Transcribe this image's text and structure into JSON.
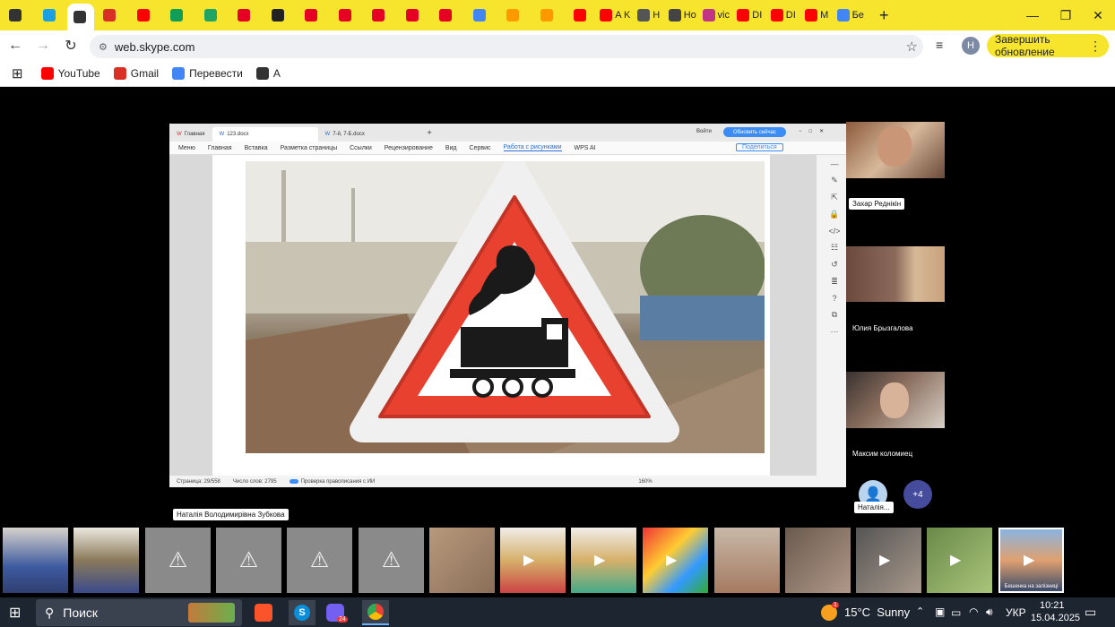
{
  "browser": {
    "tabs": [
      {
        "label": "",
        "icon": "chevron-down-icon",
        "color": "#333333"
      },
      {
        "label": "",
        "icon": "s-logo-icon",
        "color": "#1ba1e2"
      },
      {
        "label": "",
        "icon": "speaker-icon",
        "color": "#333333"
      },
      {
        "label": "",
        "icon": "gmail-icon",
        "color": "#d93025"
      },
      {
        "label": "",
        "icon": "youtube-icon",
        "color": "#ff0000"
      },
      {
        "label": "",
        "icon": "sheets-icon",
        "color": "#0f9d58"
      },
      {
        "label": "",
        "icon": "plus-green-icon",
        "color": "#1fa463"
      },
      {
        "label": "",
        "icon": "pinterest-icon",
        "color": "#e60023"
      },
      {
        "label": "",
        "icon": "hypothesis-icon",
        "color": "#222222"
      },
      {
        "label": "",
        "icon": "pinterest-icon",
        "color": "#e60023"
      },
      {
        "label": "",
        "icon": "pinterest-icon",
        "color": "#e60023"
      },
      {
        "label": "",
        "icon": "pinterest-icon",
        "color": "#e60023"
      },
      {
        "label": "",
        "icon": "pinterest-icon",
        "color": "#e60023"
      },
      {
        "label": "",
        "icon": "pinterest-icon",
        "color": "#e60023"
      },
      {
        "label": "",
        "icon": "google-icon",
        "color": "#4285f4"
      },
      {
        "label": "",
        "icon": "amazon-icon",
        "color": "#ff9900"
      },
      {
        "label": "",
        "icon": "amazon-icon",
        "color": "#ff9900"
      },
      {
        "label": "",
        "icon": "youtube-icon",
        "color": "#ff0000"
      },
      {
        "label": "A K",
        "icon": "youtube-icon",
        "color": "#ff0000"
      },
      {
        "label": "H",
        "icon": "camera-icon",
        "color": "#555555"
      },
      {
        "label": "Ho",
        "icon": "globe-icon",
        "color": "#444444"
      },
      {
        "label": "vic",
        "icon": "instagram-icon",
        "color": "#c13584"
      },
      {
        "label": "DI",
        "icon": "youtube-icon",
        "color": "#ff0000"
      },
      {
        "label": "DI",
        "icon": "youtube-icon",
        "color": "#ff0000"
      },
      {
        "label": "M",
        "icon": "youtube-icon",
        "color": "#ff0000"
      },
      {
        "label": "Бе",
        "icon": "google-icon",
        "color": "#4285f4"
      }
    ],
    "url": "web.skype.com",
    "update_button": "Завершить обновление",
    "profile_initial": "H",
    "bookmarks": [
      {
        "label": "YouTube",
        "icon": "youtube-icon",
        "color": "#ff0000"
      },
      {
        "label": "Gmail",
        "icon": "gmail-icon",
        "color": "#d93025"
      },
      {
        "label": "Перевести",
        "icon": "translate-icon",
        "color": "#4285f4"
      },
      {
        "label": "A",
        "icon": "globe-icon",
        "color": "#333333"
      }
    ]
  },
  "shared_screen": {
    "wps_tabs": [
      "Главная",
      "123.docx",
      "7-й, 7-Б.docx"
    ],
    "wps_login": "Войти",
    "wps_update": "Обновить сейчас",
    "menu": [
      "Меню",
      "Главная",
      "Вставка",
      "Разметка страницы",
      "Ссылки",
      "Рецензирование",
      "Вид",
      "Сервис",
      "Работа с рисунками",
      "WPS AI"
    ],
    "share_btn": "Поделиться",
    "status": {
      "page": "Страница: 29/558",
      "words": "Число слов: 2795",
      "spell": "Проверка правописания с ИИ",
      "zoom": "160%"
    }
  },
  "participants": [
    {
      "name": "Захар Реднікін"
    },
    {
      "name": "Юлия Брызгалова"
    },
    {
      "name": "Максим коломиец"
    },
    {
      "name": "Наталія..."
    }
  ],
  "more_participants": "+4",
  "presenter_label": "Наталія Володимирівна Зубкова",
  "filmstrip_caption": "Бешенка на залізниці",
  "taskbar": {
    "search_placeholder": "Поиск",
    "weather": "15°C  Sunny",
    "language": "УКР",
    "time": "10:21",
    "date": "15.04.2025",
    "notification_count": "1",
    "viber_badge": "24"
  }
}
